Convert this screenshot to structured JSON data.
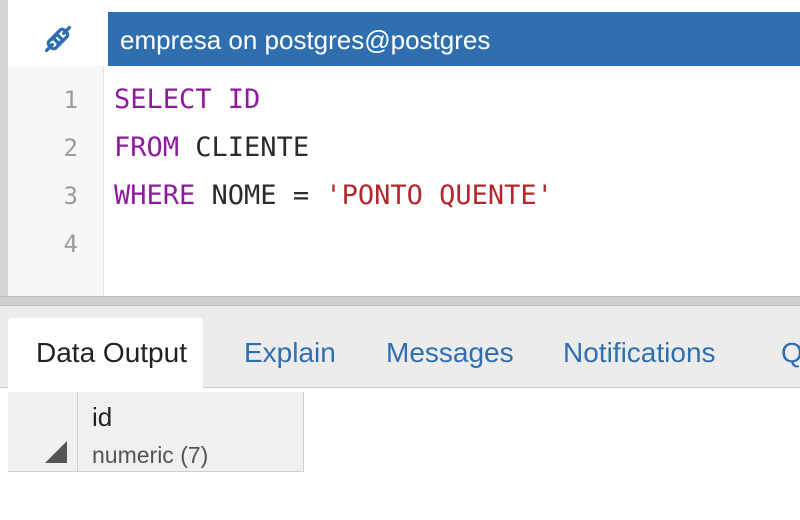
{
  "titlebar": {
    "connection_icon": "connection-plug-icon",
    "title": "empresa on postgres@postgres",
    "accent_color": "#2f6fb0"
  },
  "editor": {
    "line_numbers": [
      "1",
      "2",
      "3",
      "4"
    ],
    "lines": [
      [
        {
          "t": "SELECT ID",
          "c": "kw"
        }
      ],
      [
        {
          "t": "FROM",
          "c": "kw"
        },
        {
          "t": " CLIENTE",
          "c": ""
        }
      ],
      [
        {
          "t": "WHERE",
          "c": "kw"
        },
        {
          "t": " NOME = ",
          "c": ""
        },
        {
          "t": "'PONTO QUENTE'",
          "c": "str"
        }
      ],
      []
    ]
  },
  "tabs": [
    {
      "label": "Data Output",
      "active": true
    },
    {
      "label": "Explain",
      "active": false
    },
    {
      "label": "Messages",
      "active": false
    },
    {
      "label": "Notifications",
      "active": false
    },
    {
      "label": "Q",
      "active": false
    }
  ],
  "grid": {
    "columns": [
      {
        "name": "id",
        "type": "numeric (7)"
      }
    ]
  }
}
